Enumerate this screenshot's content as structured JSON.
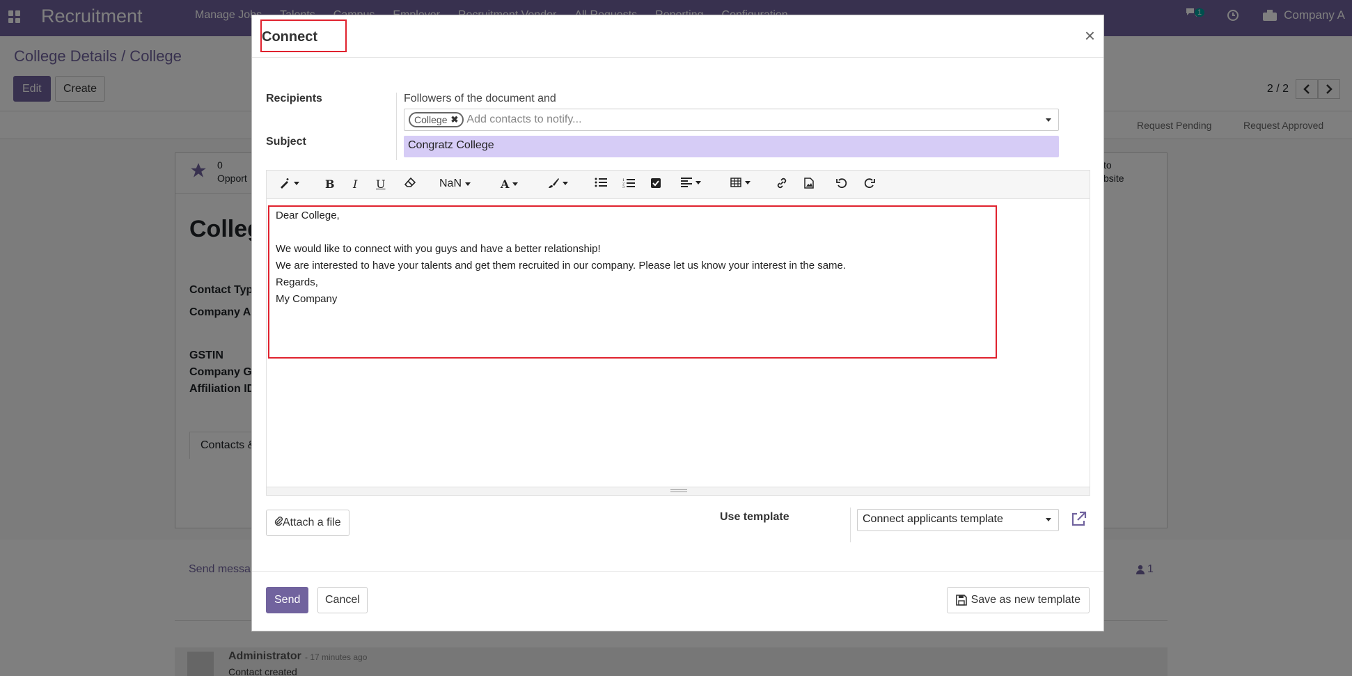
{
  "navbar": {
    "app_title": "Recruitment",
    "menu": [
      "Manage Jobs",
      "Talents",
      "Campus",
      "Employer",
      "Recruitment Vendor",
      "All Requests",
      "Reporting",
      "Configuration"
    ],
    "message_count": "1",
    "company": "Company A"
  },
  "control": {
    "breadcrumb": "College Details / College",
    "edit_label": "Edit",
    "create_label": "Create",
    "pager": "2 / 2"
  },
  "background": {
    "stages": [
      "Request Pending",
      "Request Approved"
    ],
    "stat_count": "0",
    "stat_label": "Opport",
    "right_stat_1": "to",
    "right_stat_2": "bsite",
    "name": "Colleg",
    "fields": [
      "Contact Typ",
      "Company A",
      "GSTIN",
      "Company G",
      "Affiliation ID"
    ],
    "tab": "Contacts &",
    "send_message": "Send messa",
    "followers_count": "1",
    "author": "Administrator",
    "time": "- 17 minutes ago",
    "log": "Contact created"
  },
  "modal": {
    "title": "Connect",
    "close": "×",
    "recipients_label": "Recipients",
    "followers_text": "Followers of the document and",
    "recipient_tag": "College",
    "recipient_placeholder": "Add contacts to notify...",
    "subject_label": "Subject",
    "subject_value": "Congratz College",
    "toolbar": {
      "font_size": "NaN"
    },
    "body_lines": [
      "Dear College,",
      "",
      "We would like to connect with you guys and have a better relationship!",
      "We are interested to have your talents and get them recruited in our company. Please let us know your interest in the same.",
      "Regards,",
      "My Company"
    ],
    "attach_label": "Attach a file",
    "template_label": "Use template",
    "template_value": "Connect applicants template",
    "send_label": "Send",
    "cancel_label": "Cancel",
    "save_template_label": "Save as new template"
  },
  "colors": {
    "brand": "#71639e",
    "subject_bg": "#d6ccf6",
    "highlight": "#e0222e"
  }
}
